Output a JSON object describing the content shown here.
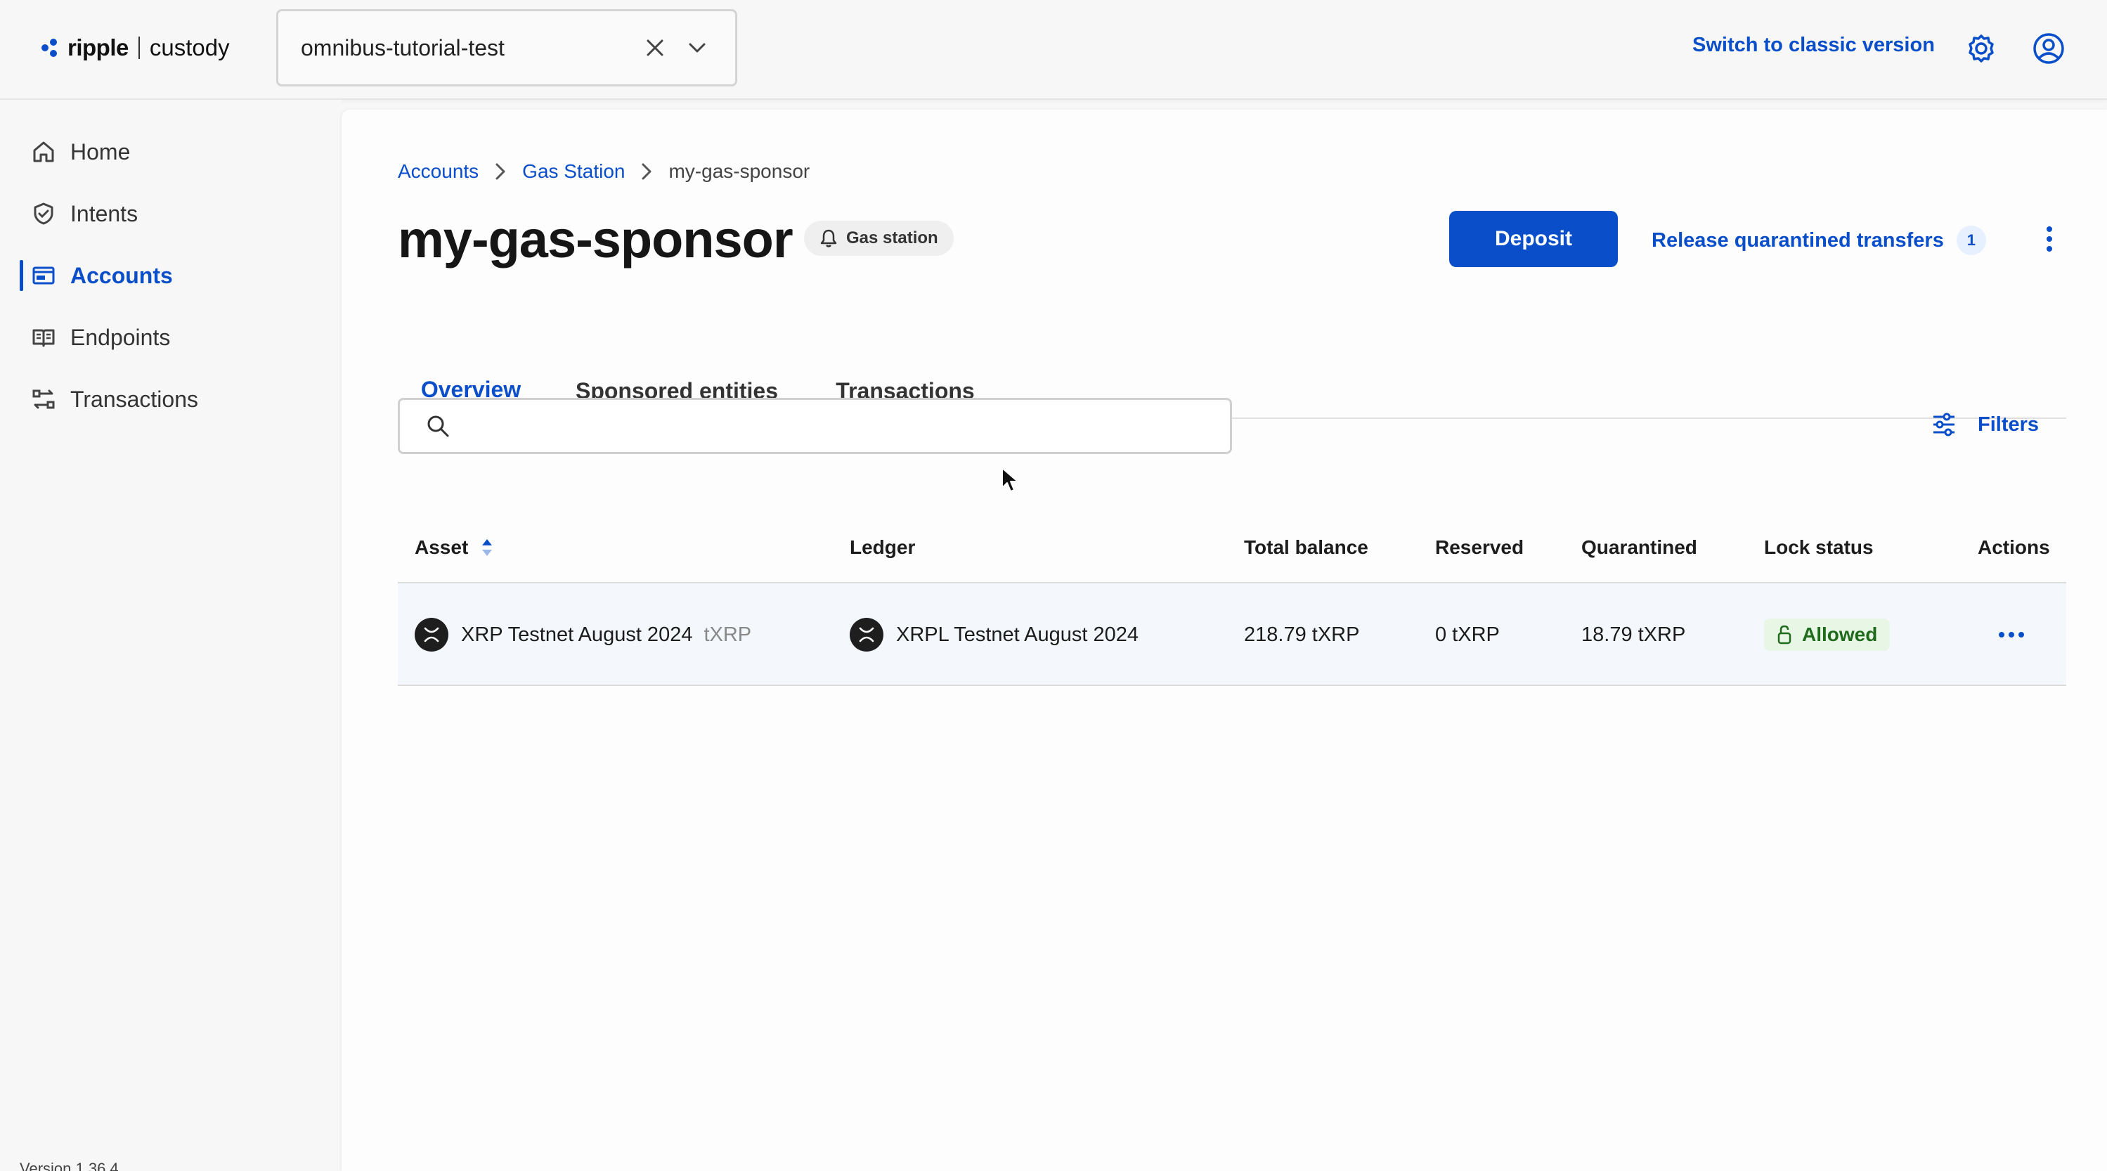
{
  "header": {
    "brand": "ripple",
    "product": "custody",
    "org_selector_value": "omnibus-tutorial-test",
    "classic_link": "Switch to classic version"
  },
  "sidebar": {
    "items": [
      {
        "label": "Home",
        "icon": "home-icon"
      },
      {
        "label": "Intents",
        "icon": "shield-icon"
      },
      {
        "label": "Accounts",
        "icon": "wallet-icon",
        "active": true
      },
      {
        "label": "Endpoints",
        "icon": "book-icon"
      },
      {
        "label": "Transactions",
        "icon": "transfer-icon"
      }
    ],
    "version": "Version 1.36.4"
  },
  "breadcrumb": {
    "items": [
      "Accounts",
      "Gas Station"
    ],
    "current": "my-gas-sponsor"
  },
  "page": {
    "title": "my-gas-sponsor",
    "type_badge": "Gas station",
    "deposit_label": "Deposit",
    "release_label": "Release quarantined transfers",
    "release_count": "1"
  },
  "tabs": [
    "Overview",
    "Sponsored entities",
    "Transactions"
  ],
  "search": {
    "placeholder": "",
    "value": ""
  },
  "filters_label": "Filters",
  "table": {
    "headers": [
      "Asset",
      "Ledger",
      "Total balance",
      "Reserved",
      "Quarantined",
      "Lock status",
      "Actions"
    ],
    "rows": [
      {
        "asset": "XRP Testnet August 2024",
        "symbol": "tXRP",
        "ledger": "XRPL Testnet August 2024",
        "total_balance": "218.79 tXRP",
        "reserved": "0 tXRP",
        "quarantined": "18.79 tXRP",
        "lock_status": "Allowed"
      }
    ]
  },
  "colors": {
    "accent": "#0a4fc9",
    "status_allowed_bg": "#e8f6e6",
    "status_allowed_text": "#1f6b1c"
  }
}
